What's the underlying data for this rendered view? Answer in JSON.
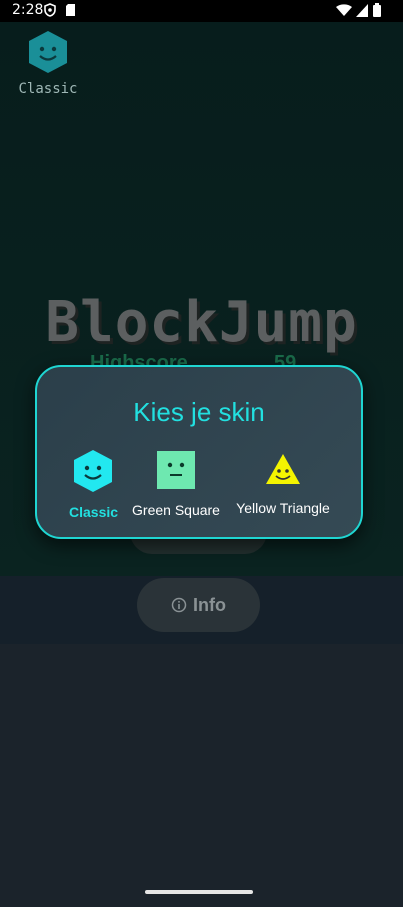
{
  "status_bar": {
    "time": "2:28",
    "icons": [
      "shield-icon",
      "sd-card-icon",
      "wifi-icon",
      "signal-icon",
      "battery-icon"
    ]
  },
  "game": {
    "current_skin_label": "Classic",
    "title": "BlockJump",
    "highscore_label": "Highscore",
    "highscore_value": "59",
    "info_button_label": "Info"
  },
  "dialog": {
    "title": "Kies je skin",
    "skins": [
      {
        "name": "Classic",
        "selected": true,
        "color": "#22e8f0"
      },
      {
        "name": "Green Square",
        "selected": false,
        "color": "#6ee8b0"
      },
      {
        "name": "Yellow Triangle",
        "selected": false,
        "color": "#f4f400"
      }
    ]
  },
  "colors": {
    "accent": "#22e0e0",
    "background": "#1b232b"
  }
}
